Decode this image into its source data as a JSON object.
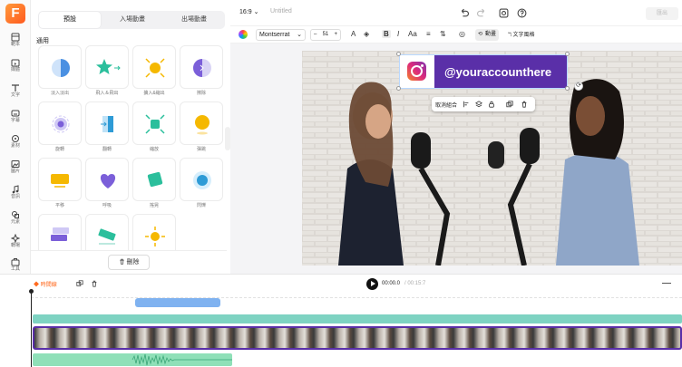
{
  "app": {
    "logo_letter": "F"
  },
  "sidebar": {
    "items": [
      {
        "label": "範本",
        "icon": "template-icon"
      },
      {
        "label": "媒體",
        "icon": "media-icon"
      },
      {
        "label": "文字",
        "icon": "text-icon"
      },
      {
        "label": "字幕",
        "icon": "subtitle-icon"
      },
      {
        "label": "素材",
        "icon": "element-icon"
      },
      {
        "label": "圖片",
        "icon": "image-icon"
      },
      {
        "label": "音訊",
        "icon": "audio-icon"
      },
      {
        "label": "元素",
        "icon": "shape-icon"
      },
      {
        "label": "轉場",
        "icon": "transition-icon"
      },
      {
        "label": "工具",
        "icon": "tools-icon"
      }
    ]
  },
  "panel": {
    "tabs": [
      "預設",
      "入場動畫",
      "出場動畫"
    ],
    "active_tab": 0,
    "section_title": "通用",
    "presets": [
      "淡入淡出",
      "飛入＆飛出",
      "擴入&縮出",
      "擦除",
      "旋轉",
      "翻轉",
      "縮放",
      "彈跳",
      "平移",
      "呼吸",
      "搖晃",
      "閃爍",
      "",
      "",
      ""
    ],
    "delete_label": "刪除"
  },
  "topbar": {
    "ratio": "16:9",
    "title": "Untitled",
    "export_label": "匯出"
  },
  "toolbar": {
    "font": "Montserrat",
    "size": "51",
    "animation_label": "動畫",
    "text_effect_label": "文字風格"
  },
  "canvas": {
    "handle_text": "@youraccounthere",
    "ungroup_label": "取消組合"
  },
  "timeline": {
    "chip_label": "時間線",
    "current_time": "00:00.0",
    "total_time": "/ 00:15:7"
  },
  "colors": {
    "accent": "#ff6a1f",
    "banner": "#5a2fa8",
    "text_clip": "#7fb2f0",
    "anim_track": "#7ed3c2",
    "audio_track": "#8fe0b8"
  }
}
